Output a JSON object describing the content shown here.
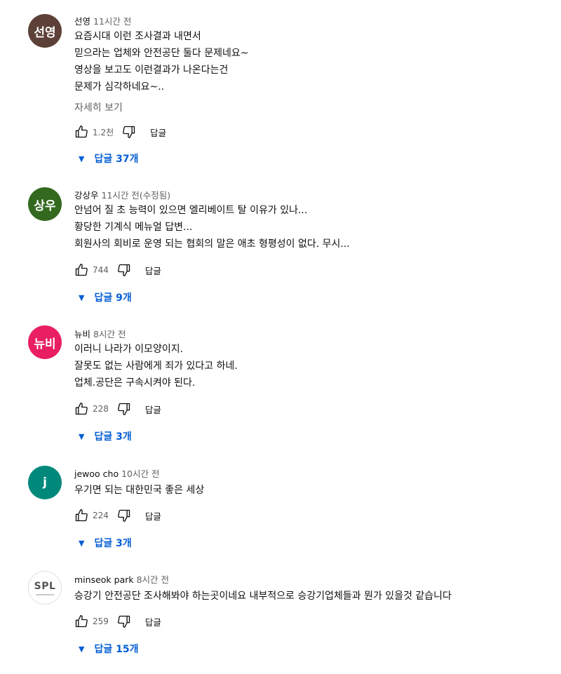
{
  "comments": [
    {
      "avatar_text": "선영",
      "avatar_color": "#5d4037",
      "author": "선영",
      "time": "11시간 전",
      "lines": [
        "요즘시대 이런 조사결과 내면서",
        "믿으라는 업체와 안전공단 둘다 문제네요~",
        "영상을 보고도 이런결과가 나온다는건",
        "문제가 심각하네요~.."
      ],
      "read_more": "자세히 보기",
      "likes": "1.2천",
      "reply_label": "답글",
      "replies_label": "답글 37개"
    },
    {
      "avatar_text": "상우",
      "avatar_color": "#33691e",
      "author": "강상우",
      "time": "11시간 전(수정됨)",
      "lines": [
        "안넘어 질 초 능력이 있으면 엘리베이트 탈 이유가 있나...",
        "황당한 기계식 메뉴얼 답변...",
        "회원사의 회비로 운영 되는 협회의 말은 애초 형평성이 없다. 무시..."
      ],
      "likes": "744",
      "reply_label": "답글",
      "replies_label": "답글 9개"
    },
    {
      "avatar_text": "뉴비",
      "avatar_color": "#e91e63",
      "author": "뉴비",
      "time": "8시간 전",
      "lines": [
        "이러니 나라가 이모양이지.",
        "잘못도 없는 사람에게 죄가 있다고 하네.",
        "업체.공단은 구속시켜야 된다."
      ],
      "likes": "228",
      "reply_label": "답글",
      "replies_label": "답글 3개"
    },
    {
      "avatar_text": "j",
      "avatar_color": "#00897b",
      "author": "jewoo cho",
      "time": "10시간 전",
      "lines": [
        "우기면 되는 대한민국 좋은 세상"
      ],
      "likes": "224",
      "reply_label": "답글",
      "replies_label": "답글 3개"
    },
    {
      "avatar_text": "SPL",
      "avatar_color": "#ffffff",
      "author": "minseok park",
      "time": "8시간 전",
      "lines": [
        "승강기 안전공단 조사해봐야 하는곳이네요 내부적으로 승강기업체들과 뭔가 있을것 같습니다"
      ],
      "likes": "259",
      "reply_label": "답글",
      "replies_label": "답글 15개"
    }
  ]
}
